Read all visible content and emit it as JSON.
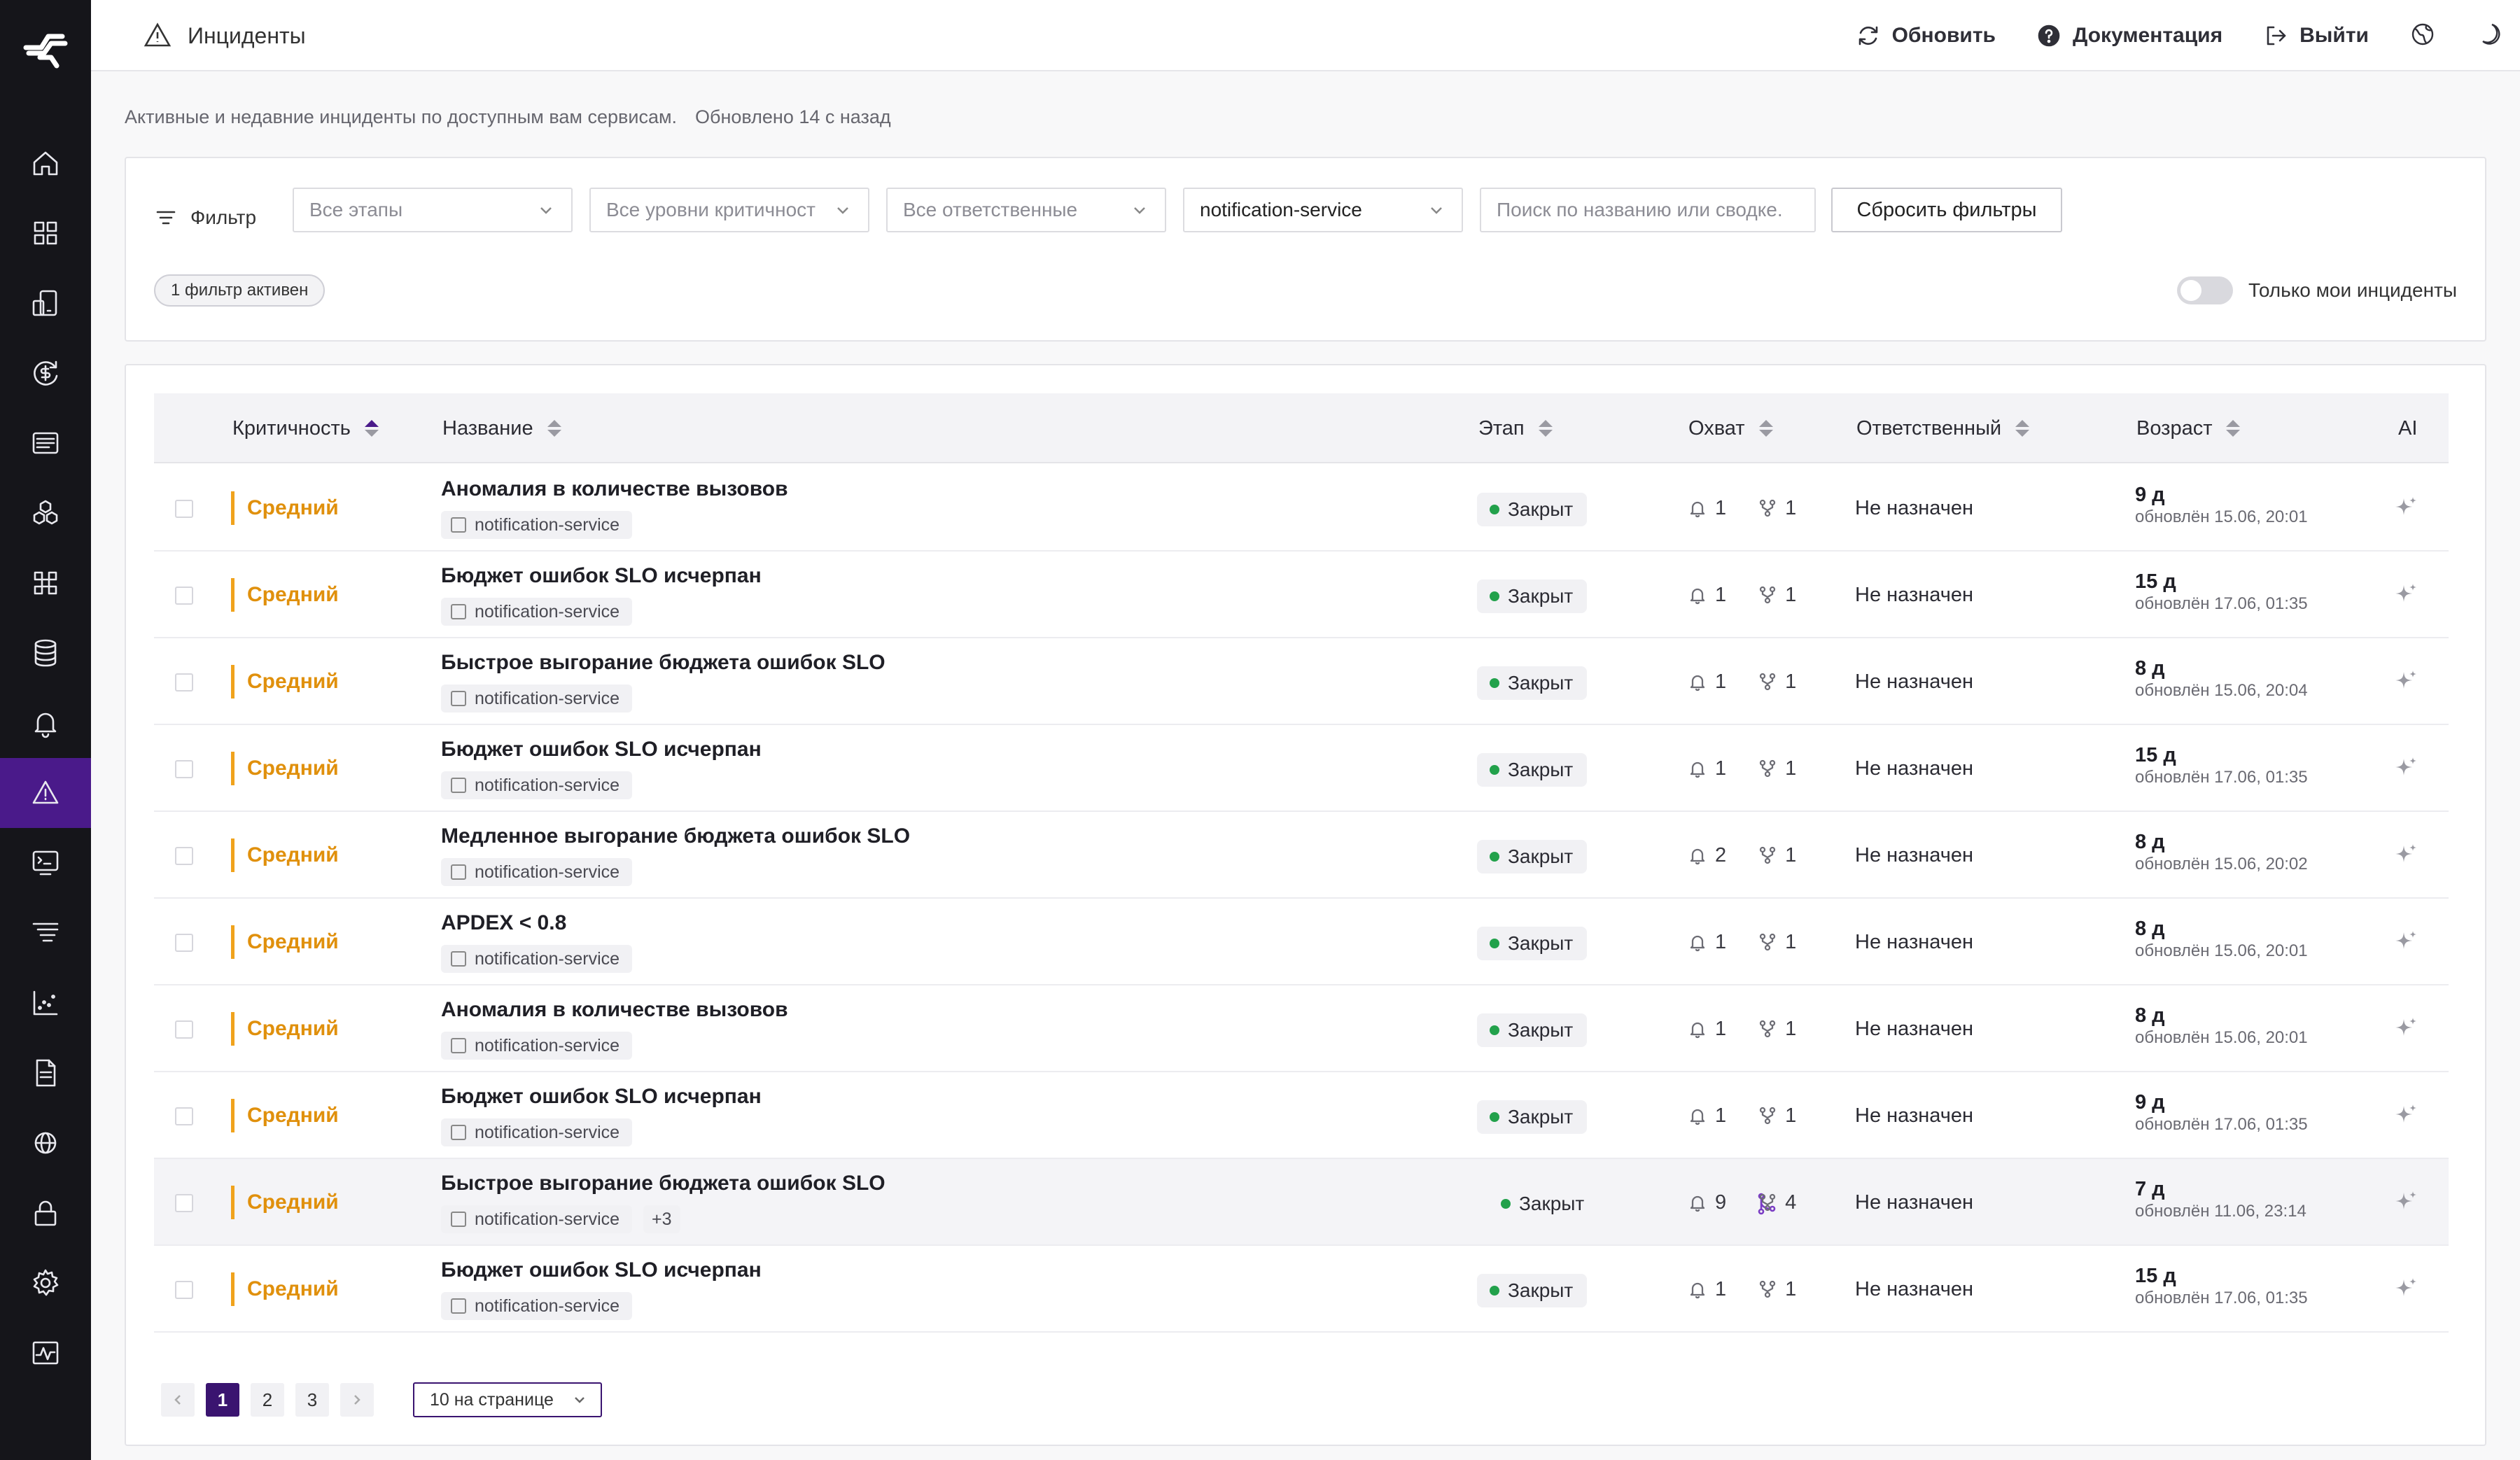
{
  "header": {
    "title": "Инциденты",
    "refresh": "Обновить",
    "docs": "Документация",
    "logout": "Выйти"
  },
  "page": {
    "subtitle": "Активные и недавние инциденты по доступным вам сервисам.",
    "updated": "Обновлено 14 с назад"
  },
  "filters": {
    "label": "Фильтр",
    "stage": "Все этапы",
    "severity": "Все уровни критичност",
    "owner": "Все ответственные",
    "service": "notification-service",
    "search_placeholder": "Поиск по названию или сводке.",
    "reset": "Сбросить фильтры",
    "active_chip": "1 фильтр активен",
    "only_mine": "Только мои инциденты"
  },
  "table": {
    "columns": {
      "severity": "Критичность",
      "name": "Название",
      "stage": "Этап",
      "reach": "Охват",
      "owner": "Ответственный",
      "age": "Возраст",
      "ai": "AI"
    },
    "rows": [
      {
        "severity": "Средний",
        "name": "Аномалия в количестве вызовов",
        "service": "notification-service",
        "stage": "Закрыт",
        "alerts": "1",
        "services": "1",
        "owner": "Не назначен",
        "age": "9 д",
        "updated": "обновлён 15.06, 20:01"
      },
      {
        "severity": "Средний",
        "name": "Бюджет ошибок SLO исчерпан",
        "service": "notification-service",
        "stage": "Закрыт",
        "alerts": "1",
        "services": "1",
        "owner": "Не назначен",
        "age": "15 д",
        "updated": "обновлён 17.06, 01:35"
      },
      {
        "severity": "Средний",
        "name": "Быстрое выгорание бюджета ошибок SLO",
        "service": "notification-service",
        "stage": "Закрыт",
        "alerts": "1",
        "services": "1",
        "owner": "Не назначен",
        "age": "8 д",
        "updated": "обновлён 15.06, 20:04"
      },
      {
        "severity": "Средний",
        "name": "Бюджет ошибок SLO исчерпан",
        "service": "notification-service",
        "stage": "Закрыт",
        "alerts": "1",
        "services": "1",
        "owner": "Не назначен",
        "age": "15 д",
        "updated": "обновлён 17.06, 01:35"
      },
      {
        "severity": "Средний",
        "name": "Медленное выгорание бюджета ошибок SLO",
        "service": "notification-service",
        "stage": "Закрыт",
        "alerts": "2",
        "services": "1",
        "owner": "Не назначен",
        "age": "8 д",
        "updated": "обновлён 15.06, 20:02"
      },
      {
        "severity": "Средний",
        "name": "APDEX < 0.8",
        "service": "notification-service",
        "stage": "Закрыт",
        "alerts": "1",
        "services": "1",
        "owner": "Не назначен",
        "age": "8 д",
        "updated": "обновлён 15.06, 20:01"
      },
      {
        "severity": "Средний",
        "name": "Аномалия в количестве вызовов",
        "service": "notification-service",
        "stage": "Закрыт",
        "alerts": "1",
        "services": "1",
        "owner": "Не назначен",
        "age": "8 д",
        "updated": "обновлён 15.06, 20:01"
      },
      {
        "severity": "Средний",
        "name": "Бюджет ошибок SLO исчерпан",
        "service": "notification-service",
        "stage": "Закрыт",
        "alerts": "1",
        "services": "1",
        "owner": "Не назначен",
        "age": "9 д",
        "updated": "обновлён 17.06, 01:35"
      },
      {
        "severity": "Средний",
        "name": "Быстрое выгорание бюджета ошибок SLO",
        "service": "notification-service",
        "more": "+3",
        "stage": "Закрыт",
        "alerts": "9",
        "services": "4",
        "owner": "Не назначен",
        "age": "7 д",
        "updated": "обновлён 11.06, 23:14"
      },
      {
        "severity": "Средний",
        "name": "Бюджет ошибок SLO исчерпан",
        "service": "notification-service",
        "stage": "Закрыт",
        "alerts": "1",
        "services": "1",
        "owner": "Не назначен",
        "age": "15 д",
        "updated": "обновлён 17.06, 01:35"
      }
    ]
  },
  "pagination": {
    "pages": [
      "1",
      "2",
      "3"
    ],
    "current": "1",
    "per_page": "10 на странице"
  },
  "colors": {
    "accent": "#4a1a8a",
    "severity_medium": "#e0900c",
    "closed_dot": "#22a14b",
    "sidebar_bg": "#15151a"
  }
}
